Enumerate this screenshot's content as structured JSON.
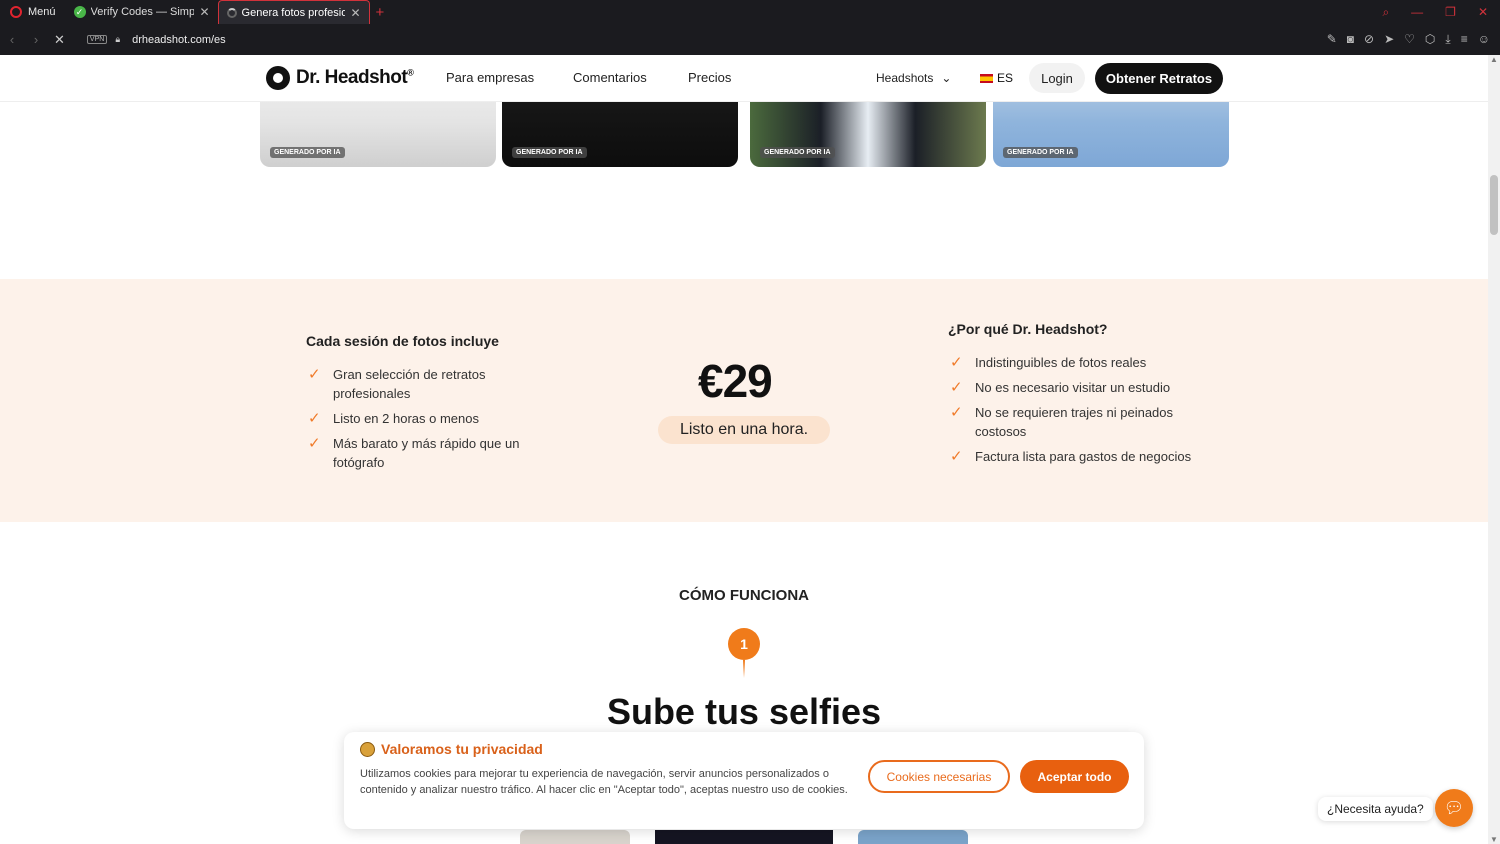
{
  "browser": {
    "menu_label": "Menú",
    "tabs": [
      {
        "title": "Verify Codes — SimplyCodes"
      },
      {
        "title": "Genera fotos profesionales"
      }
    ],
    "vpn_label": "VPN",
    "url": "drheadshot.com/es"
  },
  "header": {
    "logo_text": "Dr. Headshot",
    "logo_reg": "®",
    "nav": [
      "Para empresas",
      "Comentarios",
      "Precios"
    ],
    "headshots_label": "Headshots",
    "lang_label": "ES",
    "login_label": "Login",
    "cta_label": "Obtener Retratos"
  },
  "photos": {
    "badge": "GENERADO POR IA"
  },
  "pricing": {
    "includes_title": "Cada sesión de fotos incluye",
    "includes": [
      "Gran selección de retratos profesionales",
      "Listo en 2 horas o menos",
      "Más barato y más rápido que un fotógrafo"
    ],
    "price": "€29",
    "ready_label": "Listo en una hora.",
    "why_title": "¿Por qué Dr. Headshot?",
    "why": [
      "Indistinguibles de fotos reales",
      "No es necesario visitar un estudio",
      "No se requieren trajes ni peinados costosos",
      "Factura lista para gastos de negocios"
    ]
  },
  "how": {
    "title": "CÓMO FUNCIONA",
    "step_number": "1",
    "step_title": "Sube tus selfies"
  },
  "cookie": {
    "title": "Valoramos tu privacidad",
    "text": "Utilizamos cookies para mejorar tu experiencia de navegación, servir anuncios personalizados o contenido y analizar nuestro tráfico. Al hacer clic en \"Aceptar todo\", aceptas nuestro uso de cookies.",
    "necessary_label": "Cookies necesarias",
    "accept_label": "Aceptar todo"
  },
  "help": {
    "label": "¿Necesita ayuda?"
  },
  "colors": {
    "accent": "#e8600f",
    "pricing_bg": "#fdf2ea",
    "cta_bg": "#111111"
  }
}
